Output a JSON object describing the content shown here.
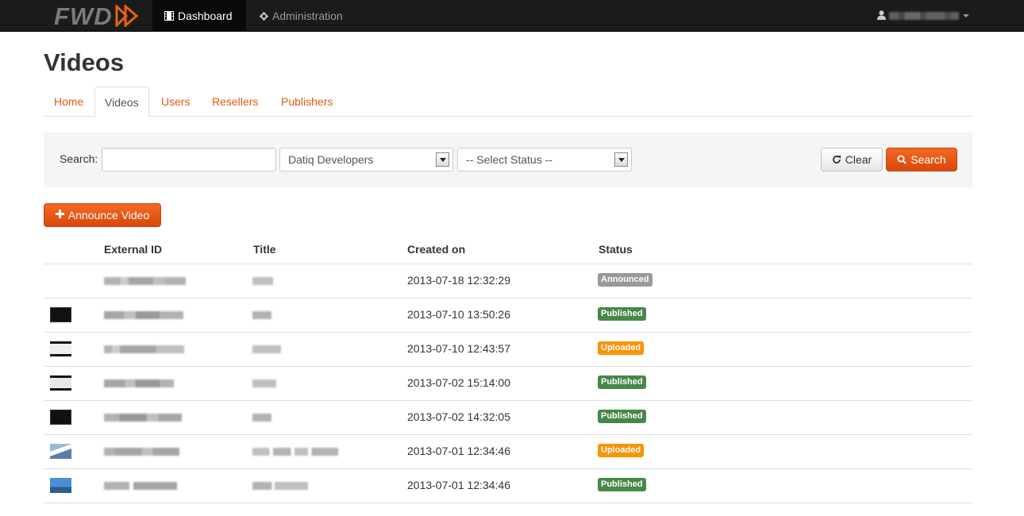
{
  "navbar": {
    "brand": "FWD",
    "items": [
      {
        "label": "Dashboard",
        "icon": "film-icon",
        "active": true
      },
      {
        "label": "Administration",
        "icon": "gear-icon",
        "active": false
      }
    ],
    "user_icon": "user-icon"
  },
  "page": {
    "title": "Videos"
  },
  "tabs": [
    {
      "label": "Home",
      "active": false
    },
    {
      "label": "Videos",
      "active": true
    },
    {
      "label": "Users",
      "active": false
    },
    {
      "label": "Resellers",
      "active": false
    },
    {
      "label": "Publishers",
      "active": false
    }
  ],
  "search": {
    "label": "Search:",
    "value": "",
    "publisher_selected": "Datiq Developers",
    "status_selected": "-- Select Status --",
    "clear_label": "Clear",
    "search_label": "Search"
  },
  "announce_label": "Announce Video",
  "table": {
    "headers": [
      "External ID",
      "Title",
      "Created on",
      "Status"
    ],
    "rows": [
      {
        "created": "2013-07-18 12:32:29",
        "status": "Announced",
        "status_key": "announced",
        "thumb": "none"
      },
      {
        "created": "2013-07-10 13:50:26",
        "status": "Published",
        "status_key": "published",
        "thumb": "dark"
      },
      {
        "created": "2013-07-10 12:43:57",
        "status": "Uploaded",
        "status_key": "uploaded",
        "thumb": "light-dot"
      },
      {
        "created": "2013-07-02 15:14:00",
        "status": "Published",
        "status_key": "published",
        "thumb": "light"
      },
      {
        "created": "2013-07-02 14:32:05",
        "status": "Published",
        "status_key": "published",
        "thumb": "dark"
      },
      {
        "created": "2013-07-01 12:34:46",
        "status": "Uploaded",
        "status_key": "uploaded",
        "thumb": "mountain"
      },
      {
        "created": "2013-07-01 12:34:46",
        "status": "Published",
        "status_key": "published",
        "thumb": "sky"
      }
    ]
  },
  "colors": {
    "accent": "#e05a14",
    "navbar": "#1b1b1b",
    "announced": "#999999",
    "published": "#468847",
    "uploaded": "#f89406"
  }
}
